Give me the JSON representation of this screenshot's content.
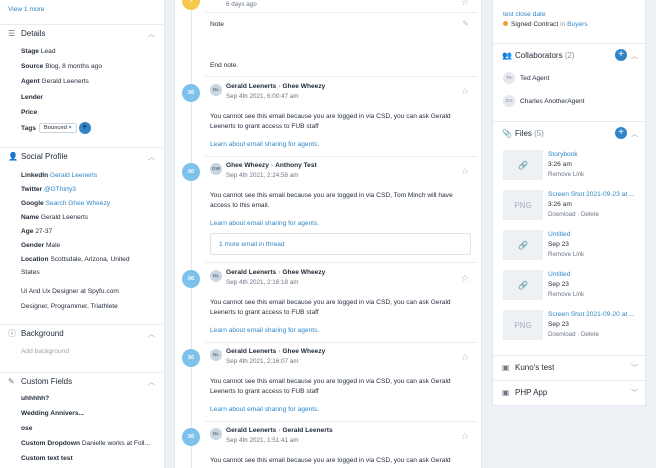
{
  "left": {
    "view_more": "View 1 more",
    "details": {
      "title": "Details",
      "stage_label": "Stage",
      "stage_value": "Lead",
      "source_label": "Source",
      "source_value": "Blog, 8 months ago",
      "agent_label": "Agent",
      "agent_value": "Gerald Leenerts",
      "lender_label": "Lender",
      "price_label": "Price",
      "tags_label": "Tags",
      "tag_chip": "Bounced",
      "tag_remove": "×",
      "add": "+"
    },
    "social": {
      "title": "Social Profile",
      "linkedin_label": "LinkedIn",
      "linkedin_value": "Gerald Leenerts",
      "twitter_label": "Twitter",
      "twitter_value": "@GThirty3",
      "google_label": "Google",
      "google_value": "Search Ghee Wheezy",
      "name_label": "Name",
      "name_value": "Gerald Leenerts",
      "age_label": "Age",
      "age_value": "27-37",
      "gender_label": "Gender",
      "gender_value": "Male",
      "location_label": "Location",
      "location_value": "Scottsdale, Arizona, United",
      "location_value2": "States",
      "bio1": "Ui And Ux Designer at Spyfu.com",
      "bio2": "Designer, Programmer, Triathlete"
    },
    "background": {
      "title": "Background",
      "placeholder": "Add background"
    },
    "custom": {
      "title": "Custom Fields",
      "f1": "uhhhhh?",
      "f2": "Wedding Annivers...",
      "f3": "ose",
      "f4_label": "Custom Dropdown",
      "f4_value": "Danielle works at Foll...",
      "f5": "Custom text test"
    }
  },
  "mid": {
    "top_time": "6 days ago",
    "note_label": "Note",
    "note_text": "End note.",
    "emails": [
      {
        "initials": "GL",
        "from": "Gerald Leenerts",
        "to": "Ghee Wheezy",
        "date": "Sep 4th 2021, 6:00:47 am",
        "body": "You cannot see this email because you are logged in via CSD, you can ask Gerald Leenerts to grant access to FUB staff",
        "learn": "Learn about email sharing for agents."
      },
      {
        "initials": "GW",
        "from": "Ghee Wheezy",
        "to": "Anthony Test",
        "date": "Sep 4th 2021, 2:24:58 am",
        "body": "You cannot see this email because you are logged in via CSD, Tom Minch will have access to this email.",
        "learn": "Learn about email sharing for agents.",
        "thread": "1 more email in thread"
      },
      {
        "initials": "GL",
        "from": "Gerald Leenerts",
        "to": "Ghee Wheezy",
        "date": "Sep 4th 2021, 2:16:18 am",
        "body": "You cannot see this email because you are logged in via CSD, you can ask Gerald Leenerts to grant access to FUB staff",
        "learn": "Learn about email sharing for agents."
      },
      {
        "initials": "GL",
        "from": "Gerald Leenerts",
        "to": "Ghee Wheezy",
        "date": "Sep 4th 2021, 2:16:07 am",
        "body": "You cannot see this email because you are logged in via CSD, you can ask Gerald Leenerts to grant access to FUB staff",
        "learn": "Learn about email sharing for agents."
      },
      {
        "initials": "GL",
        "from": "Gerald Leenerts",
        "to": "Gerald Leenerts",
        "date": "Sep 4th 2021, 1:51:41 am",
        "body": "You cannot see this email because you are logged in via CSD, you can ask Gerald"
      }
    ]
  },
  "right": {
    "top_link": "test close date",
    "top_status": "Signed Contract",
    "top_in": "in",
    "top_group": "Buyers",
    "collab_title": "Collaborators",
    "collab_count": "(2)",
    "collabs": [
      {
        "initials": "TA",
        "name": "Ted Agent"
      },
      {
        "initials": "CA",
        "name": "Charles AnotherAgent"
      }
    ],
    "files_title": "Files",
    "files_count": "(5)",
    "files": [
      {
        "thumb": "link",
        "name": "Storybook",
        "time": "3:26 am",
        "actions": "Remove Link"
      },
      {
        "thumb": "PNG",
        "name": "Screen Shot 2021-09-23 at ...",
        "time": "3:26 am",
        "actions": "Download  ·  Delete"
      },
      {
        "thumb": "link",
        "name": "Untitled",
        "time": "Sep 23",
        "actions": "Remove Link"
      },
      {
        "thumb": "link",
        "name": "Untitled",
        "time": "Sep 23",
        "actions": "Remove Link"
      },
      {
        "thumb": "PNG",
        "name": "Screen Shot 2021-09-20 at ...",
        "time": "Sep 23",
        "actions": "Download  ·  Delete"
      }
    ],
    "kuno_title": "Kuno's test",
    "php_title": "PHP App"
  }
}
